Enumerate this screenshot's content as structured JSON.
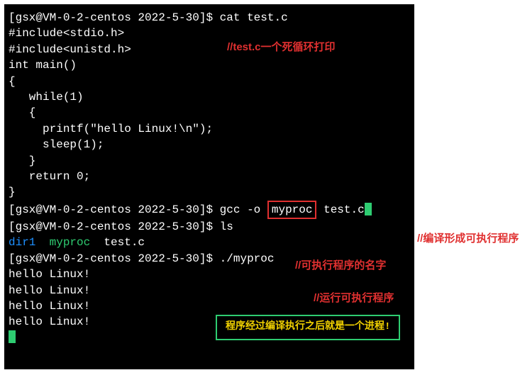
{
  "prompt_prefix": "[gsx@VM-0-2-centos 2022-5-30]$ ",
  "commands": {
    "cat": "cat test.c",
    "gcc_pre": "gcc -o ",
    "gcc_target": "myproc",
    "gcc_post": " test.c",
    "ls": "ls",
    "run": "./myproc"
  },
  "source": {
    "l1": "#include<stdio.h>",
    "l2": "#include<unistd.h>",
    "l3": "",
    "l4": "int main()",
    "l5": "{",
    "l6": "   while(1)",
    "l7": "   {",
    "l8": "     printf(\"hello Linux!\\n\");",
    "l9": "     sleep(1);",
    "l10": "   }",
    "l11": "",
    "l12": "   return 0;",
    "l13": "}"
  },
  "ls_output": {
    "dir": "dir1",
    "exe": "myproc",
    "src": "test.c"
  },
  "run_output": "hello Linux!",
  "annotations": {
    "a1": "//test.c一个死循环打印",
    "a2": "//编译形成可执行程序",
    "a3": "//可执行程序的名字",
    "a4": "//运行可执行程序",
    "box": "程序经过编译执行之后就是一个进程!"
  }
}
